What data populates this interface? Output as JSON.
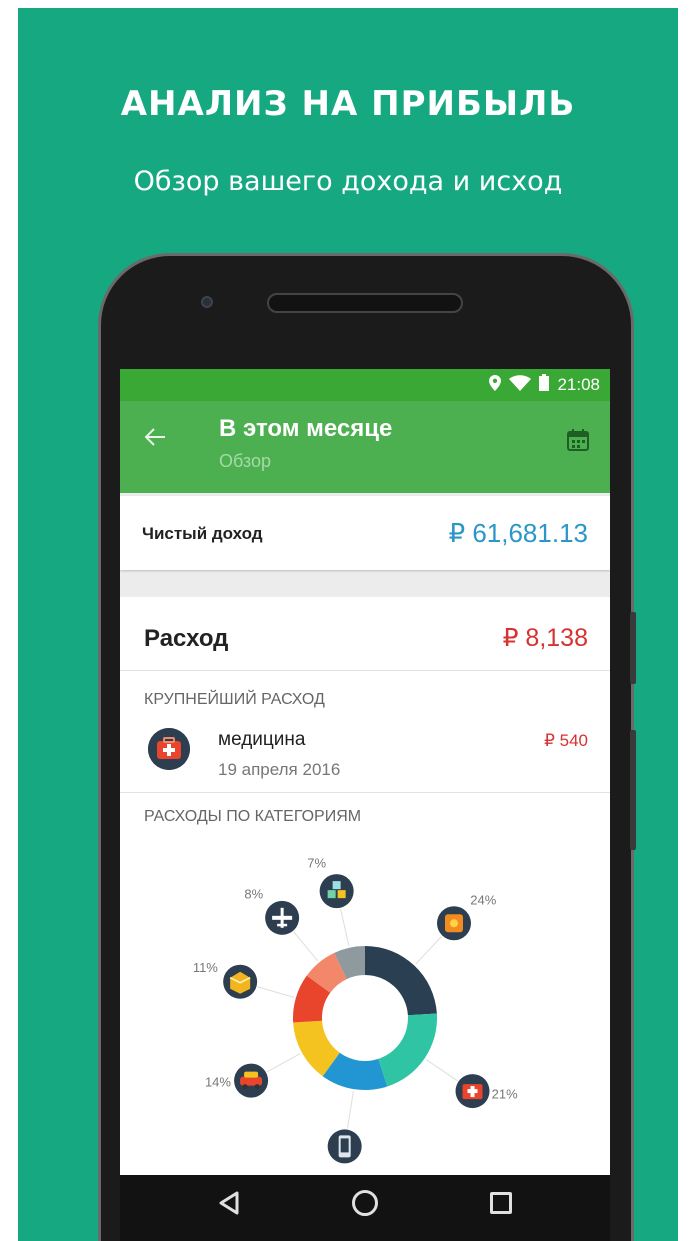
{
  "promo": {
    "title": "АНАЛИЗ НА ПРИБЫЛЬ",
    "subtitle": "Обзор вашего дохода и исход"
  },
  "status_bar": {
    "time": "21:08",
    "icons": [
      "location-icon",
      "wifi-icon",
      "battery-icon"
    ]
  },
  "app_bar": {
    "title": "В этом месяце",
    "subtitle": "Обзор",
    "back_icon": "arrow-back-icon",
    "action_icon": "calendar-icon"
  },
  "net_income": {
    "label": "Чистый доход",
    "value": "₽ 61,681.13"
  },
  "expense": {
    "label": "Расход",
    "value": "₽ 8,138",
    "biggest_section": "КРУПНЕЙШИЙ РАСХОД",
    "biggest_item": {
      "name": "медицина",
      "date": "19 апреля 2016",
      "amount": "₽ 540",
      "icon": "medkit-icon"
    },
    "categories_section": "РАСХОДЫ ПО КАТЕГОРИЯМ"
  },
  "chart_data": {
    "type": "pie",
    "title": "",
    "slices": [
      {
        "label": "24%",
        "value": 24,
        "color": "#2b3f52",
        "icon": "sun-tile-icon"
      },
      {
        "label": "21%",
        "value": 21,
        "color": "#2ec4a4",
        "icon": "medkit-icon"
      },
      {
        "label": "",
        "value": 15,
        "color": "#2196d3",
        "icon": "phone-icon"
      },
      {
        "label": "14%",
        "value": 14,
        "color": "#f5c320",
        "icon": "car-icon"
      },
      {
        "label": "11%",
        "value": 11,
        "color": "#e8452c",
        "icon": "box-icon"
      },
      {
        "label": "8%",
        "value": 8,
        "color": "#f2876a",
        "icon": "airplane-icon"
      },
      {
        "label": "7%",
        "value": 7,
        "color": "#8e9a9e",
        "icon": "cubes-icon"
      }
    ]
  },
  "nav_bar": {
    "icons": [
      "back-triangle-icon",
      "home-circle-icon",
      "recents-square-icon"
    ]
  }
}
